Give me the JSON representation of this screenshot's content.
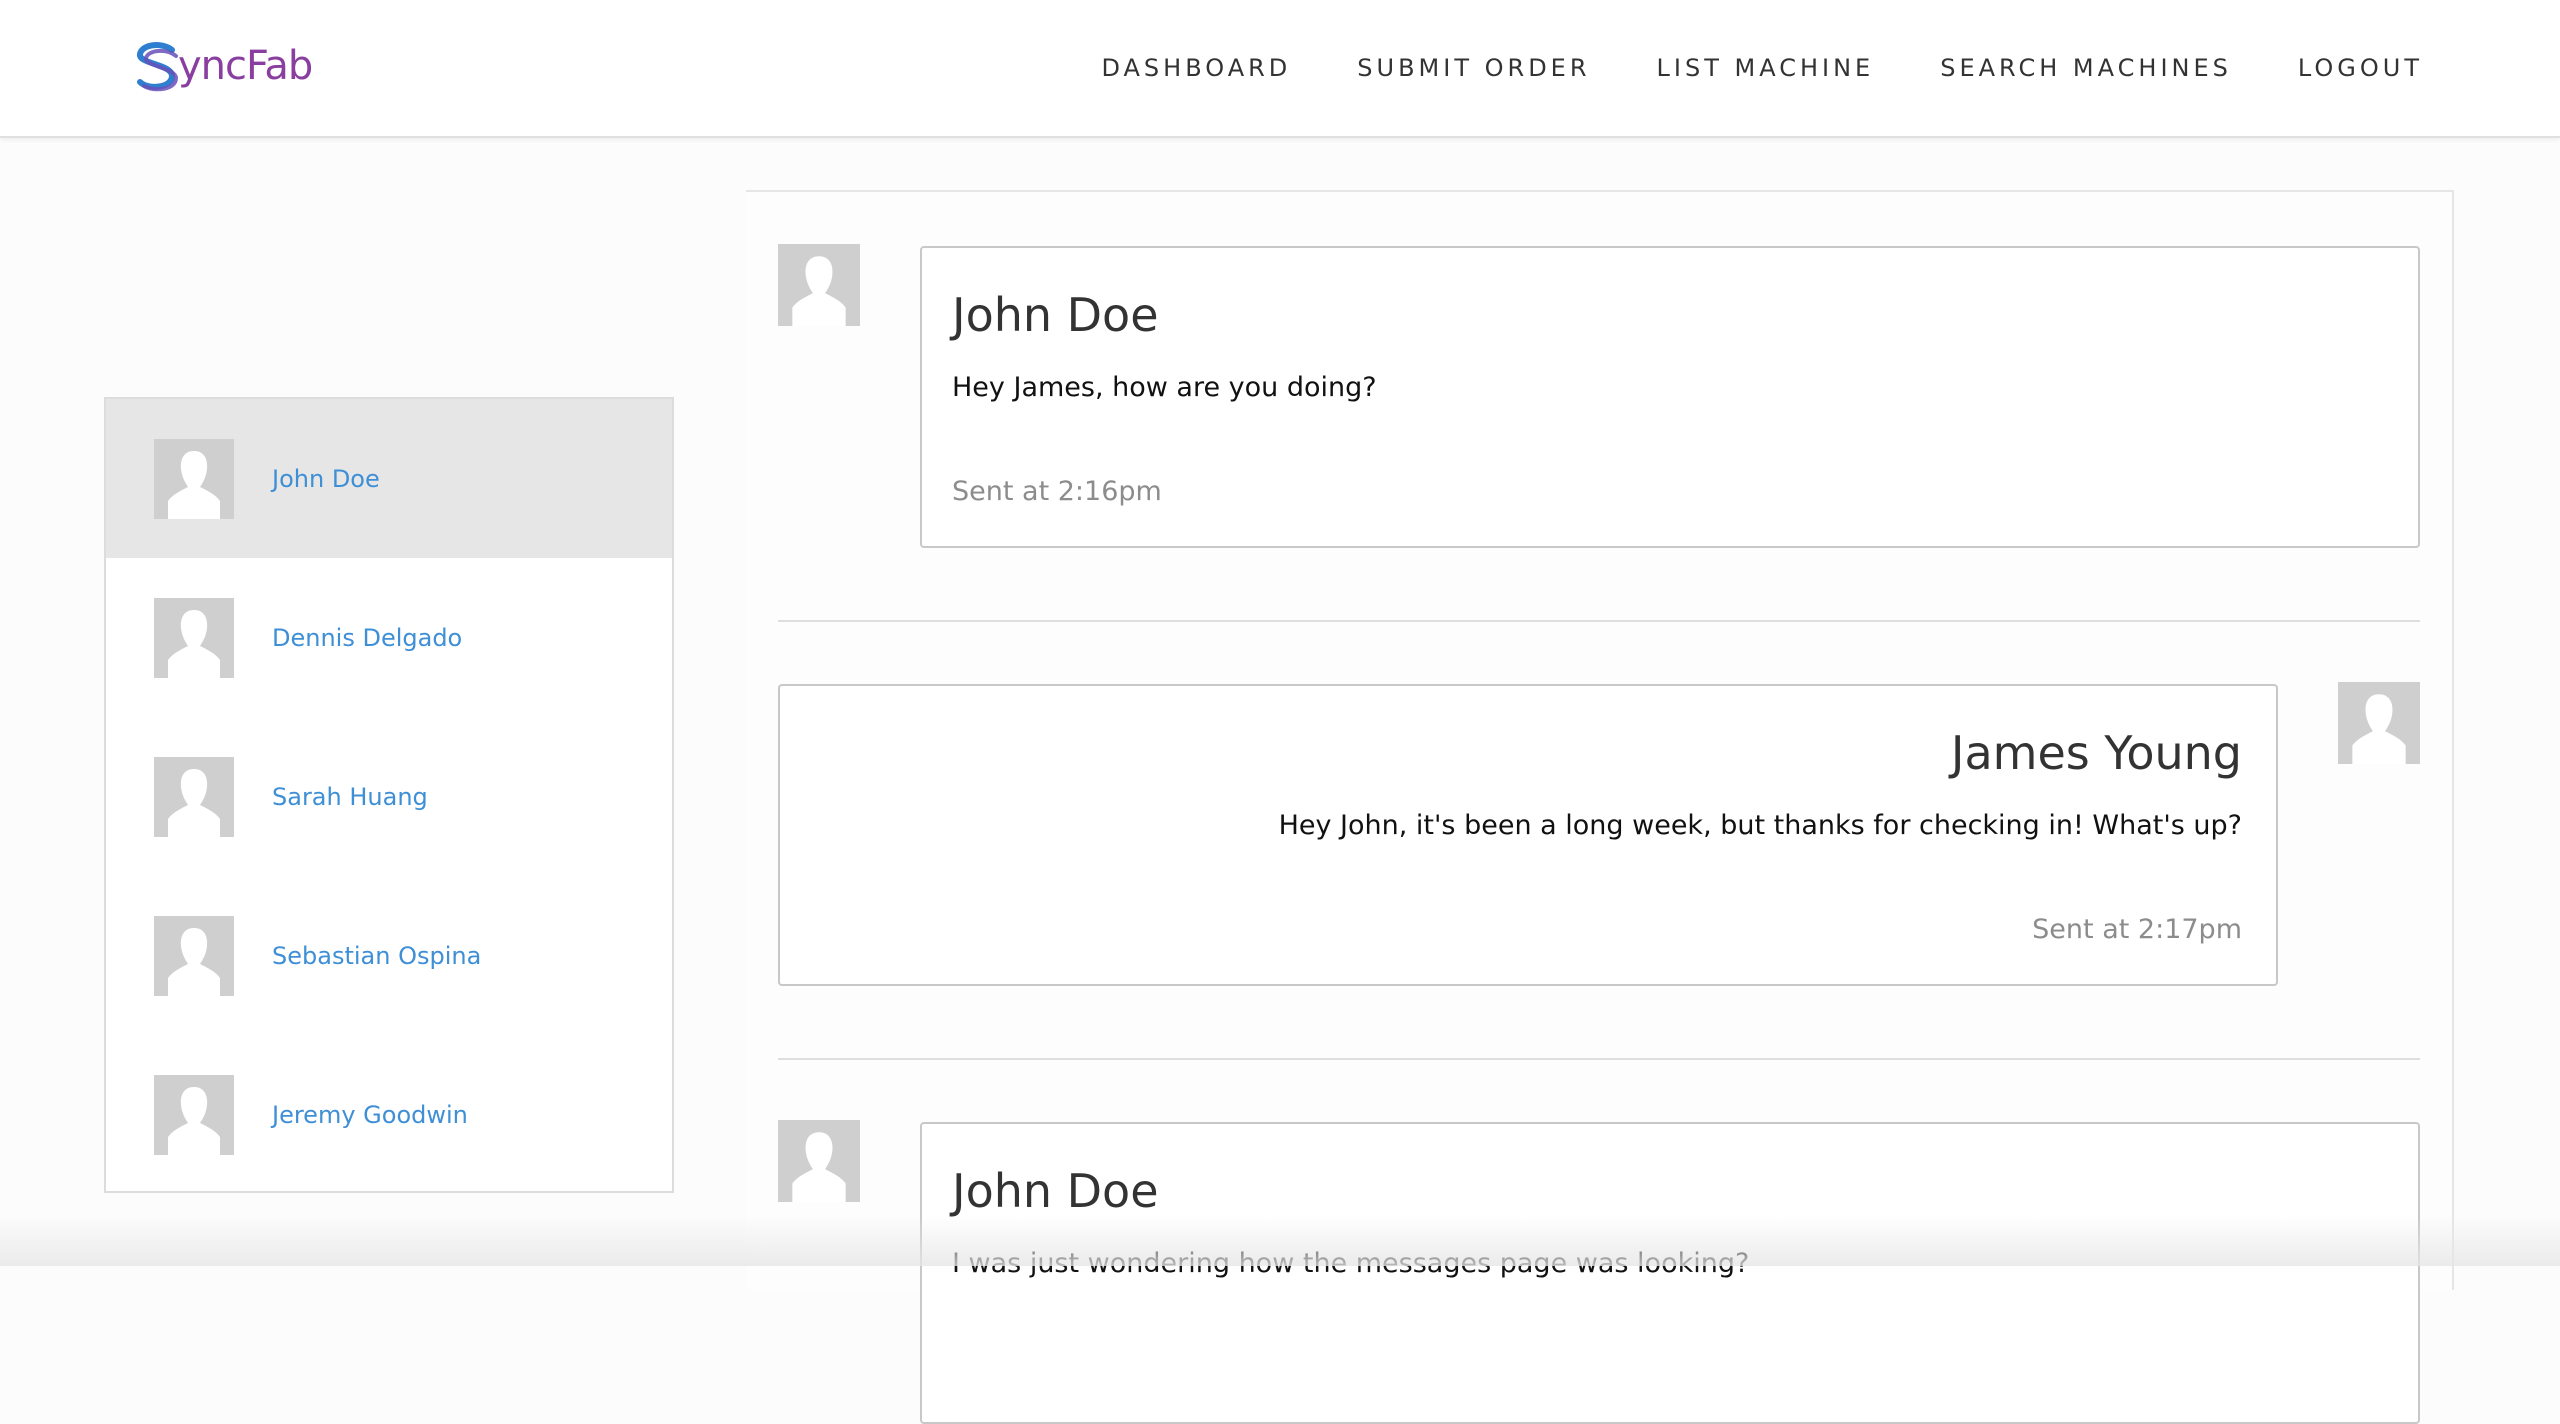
{
  "brand": {
    "logo_text": "yncFab",
    "logo_icon": "syncfab-s-logo"
  },
  "nav": {
    "items": [
      {
        "label": "DASHBOARD"
      },
      {
        "label": "SUBMIT ORDER"
      },
      {
        "label": "LIST MACHINE"
      },
      {
        "label": "SEARCH MACHINES"
      },
      {
        "label": "LOGOUT"
      }
    ]
  },
  "contacts": [
    {
      "name": "John Doe",
      "active": true
    },
    {
      "name": "Dennis Delgado",
      "active": false
    },
    {
      "name": "Sarah Huang",
      "active": false
    },
    {
      "name": "Sebastian Ospina",
      "active": false
    },
    {
      "name": "Jeremy Goodwin",
      "active": false
    }
  ],
  "messages": [
    {
      "sender": "John Doe",
      "text": "Hey James, how are you doing?",
      "time": "Sent at 2:16pm",
      "side": "left"
    },
    {
      "sender": "James Young",
      "text": "Hey John, it's been a long week, but thanks for checking in! What's up?",
      "time": "Sent at 2:17pm",
      "side": "right"
    },
    {
      "sender": "John Doe",
      "text": "I was just wondering how the messages page was looking?",
      "time": "",
      "side": "left"
    }
  ],
  "colors": {
    "accent_link": "#3e8fd6",
    "logo_purple": "#8a3fa0",
    "logo_blue": "#2f7fd0",
    "active_row": "#e6e6e6",
    "avatar_placeholder": "#cfcfcf"
  }
}
